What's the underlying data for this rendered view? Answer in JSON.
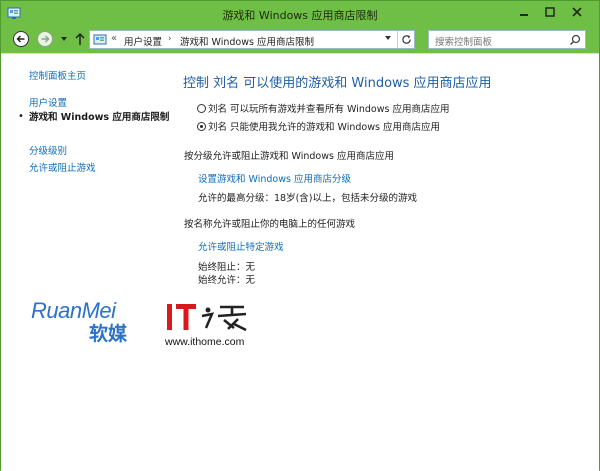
{
  "window": {
    "title": "游戏和 Windows 应用商店限制"
  },
  "navbar": {
    "address_chevron": "«",
    "breadcrumb": [
      "用户设置",
      "游戏和 Windows 应用商店限制"
    ],
    "breadcrumb_separator": "›",
    "search_placeholder": "搜索控制面板"
  },
  "sidebar": {
    "home": "控制面板主页",
    "items": [
      {
        "label": "用户设置",
        "current": false
      },
      {
        "label": "游戏和 Windows 应用商店限制",
        "current": true
      },
      {
        "label": "分级级别",
        "current": false
      },
      {
        "label": "允许或阻止游戏",
        "current": false
      }
    ],
    "current_bullet": "•"
  },
  "main": {
    "heading": "控制 刘名 可以使用的游戏和 Windows 应用商店应用",
    "options": [
      {
        "label": "刘名 可以玩所有游戏并查看所有 Windows 应用商店应用",
        "checked": false
      },
      {
        "label": "刘名 只能使用我允许的游戏和 Windows 应用商店应用",
        "checked": true
      }
    ],
    "section_rating_title": "按分级允许或阻止游戏和 Windows 应用商店应用",
    "set_rating_link": "设置游戏和 Windows 应用商店分级",
    "allowed_rating": "允许的最高分级：18岁(含)以上，包括未分级的游戏",
    "section_name_title": "按名称允许或阻止你的电脑上的任何游戏",
    "specific_games_link": "允许或阻止特定游戏",
    "always_block": "始终阻止：无",
    "always_allow": "始终允许：无"
  },
  "watermarks": {
    "ruanmei_en": "RuanMei",
    "ruanmei_cn": "软媒",
    "ithome_mark": "IT之家",
    "ithome_url": "www.ithome.com"
  },
  "colors": {
    "chrome": "#6fbf46",
    "link": "#0a6dbf",
    "heading": "#1e5fa5",
    "ithome_red": "#d7191c"
  }
}
